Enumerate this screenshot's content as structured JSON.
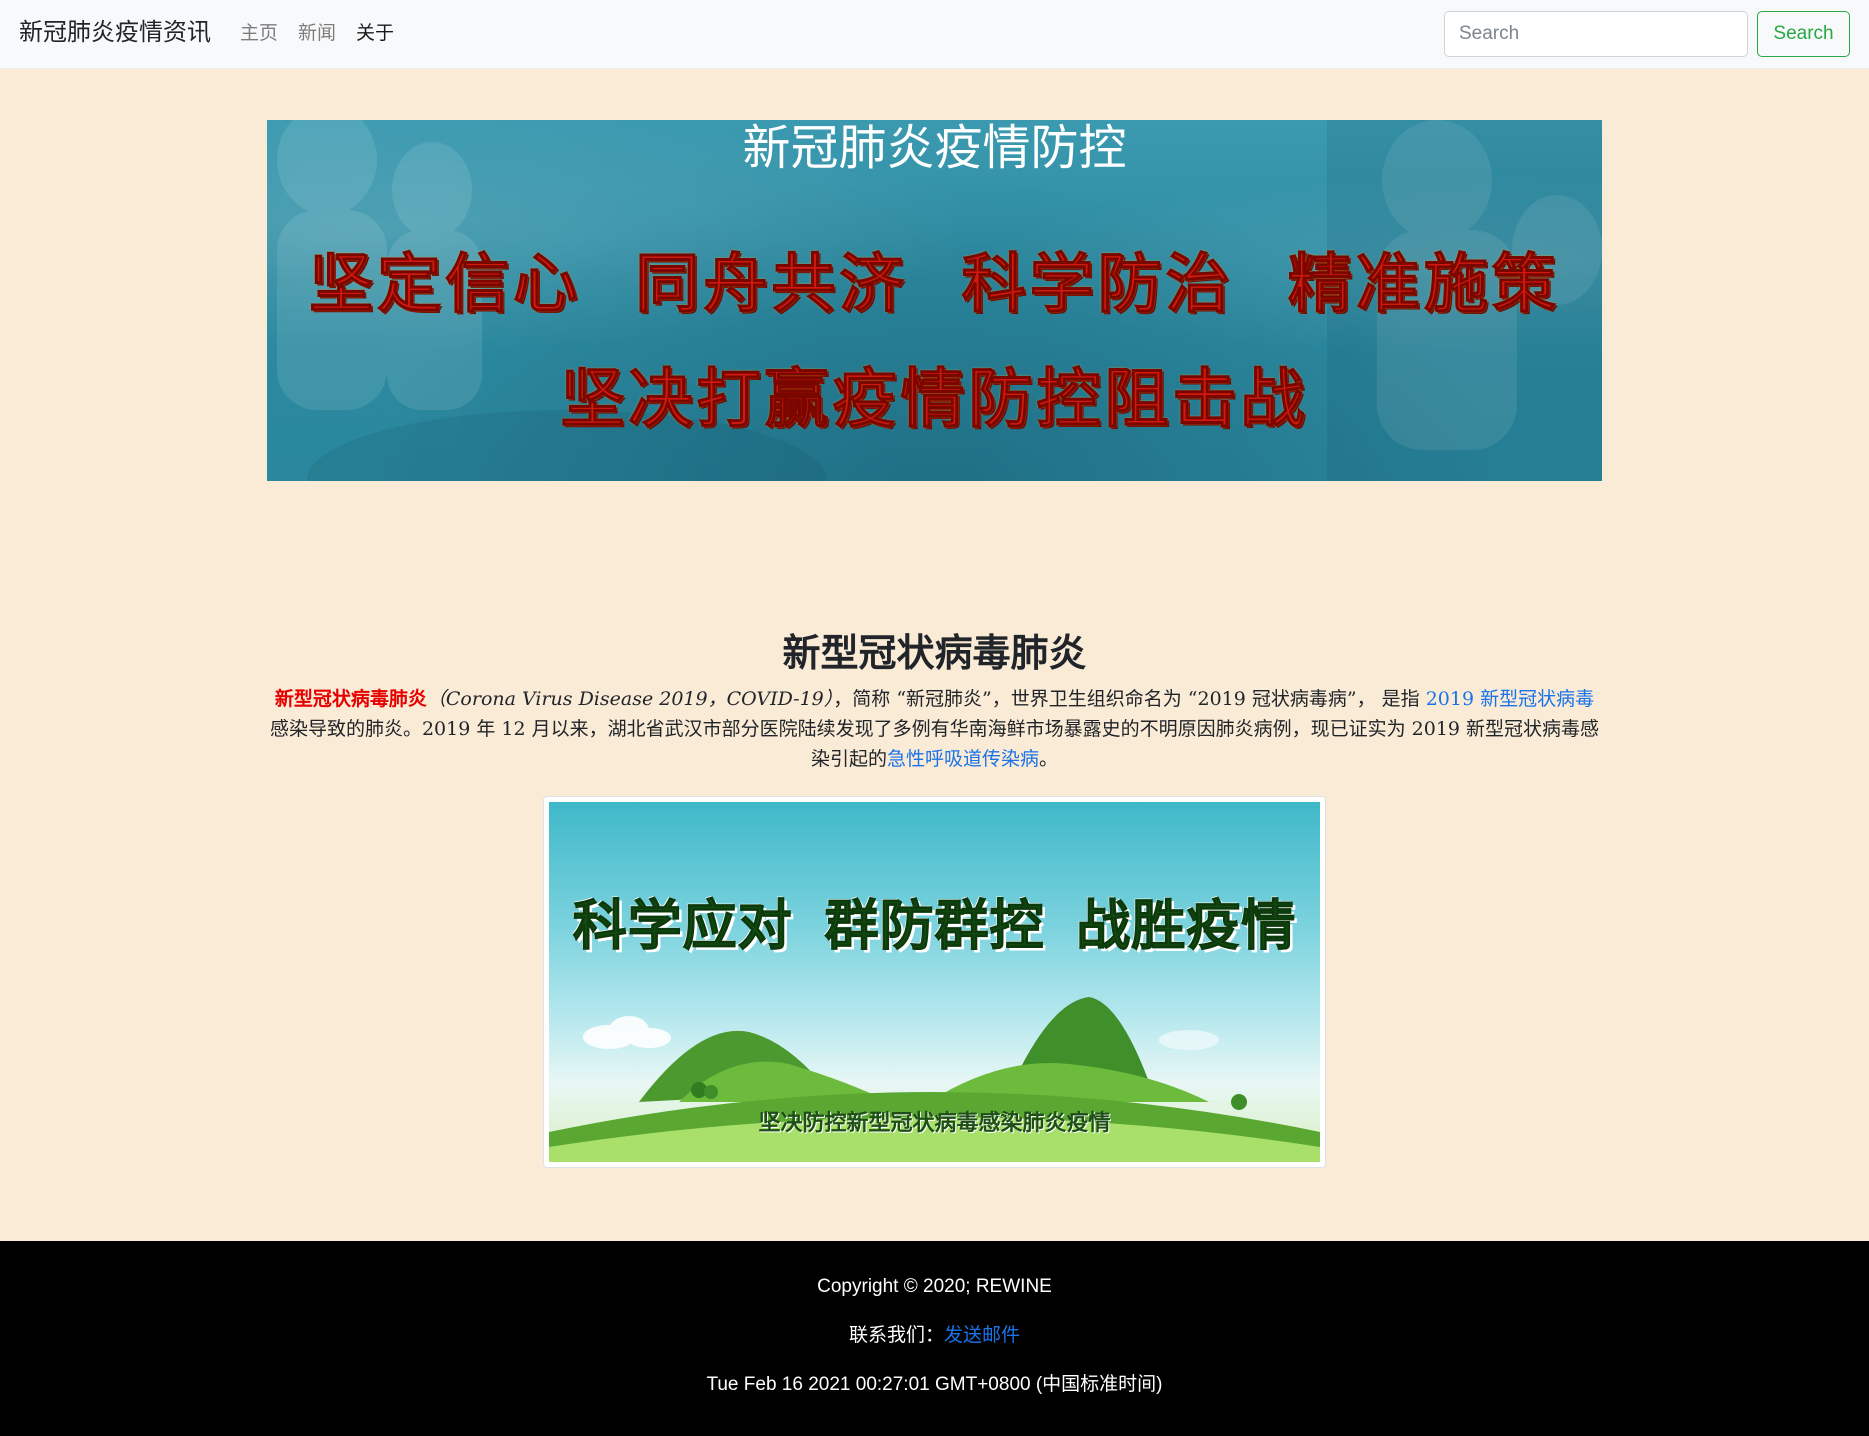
{
  "navbar": {
    "brand": "新冠肺炎疫情资讯",
    "links": [
      {
        "label": "主页",
        "active": false
      },
      {
        "label": "新闻",
        "active": false
      },
      {
        "label": "关于",
        "active": true
      }
    ],
    "search": {
      "placeholder": "Search",
      "button_label": "Search"
    }
  },
  "hero": {
    "title": "新冠肺炎疫情防控",
    "slogan_line1": "坚定信心 同舟共济 科学防治 精准施策",
    "slogan_line2": "坚决打赢疫情防控阻击战"
  },
  "article": {
    "title": "新型冠状病毒肺炎",
    "intro": {
      "term": "新型冠状病毒肺炎",
      "latin": "（Corona Virus Disease 2019，COVID-19）",
      "text1": "，简称 “新冠肺炎”，世界卫生组织命名为 “2019 冠状病毒病”， 是指 ",
      "link1": "2019 新型冠状病毒",
      "text2": "感染导致的肺炎。2019 年 12 月以来，湖北省武汉市部分医院陆续发现了多例有华南海鲜市场暴露史的不明原因肺炎病例，现已证实为 2019 新型冠状病毒感染引起的",
      "link2": "急性呼吸道传染病",
      "text3": "。"
    },
    "figure": {
      "slogan": "科学应对 群防群控 战胜疫情",
      "subtitle": "坚决防控新型冠状病毒感染肺炎疫情"
    }
  },
  "footer": {
    "copyright": "Copyright © 2020; REWINE",
    "contact_label": "联系我们：",
    "contact_link": "发送邮件",
    "datetime": "Tue Feb 16 2021 00:27:01 GMT+0800 (中国标准时间)"
  },
  "colors": {
    "page_bg": "#faebd7",
    "navbar_bg": "#f8f9fa",
    "hero_bg": "#2c8ba1",
    "slogan_red": "#d11a0f",
    "link_blue": "#1a73e8",
    "term_red": "#e60000",
    "search_green": "#28a745",
    "footer_bg": "#000000"
  }
}
